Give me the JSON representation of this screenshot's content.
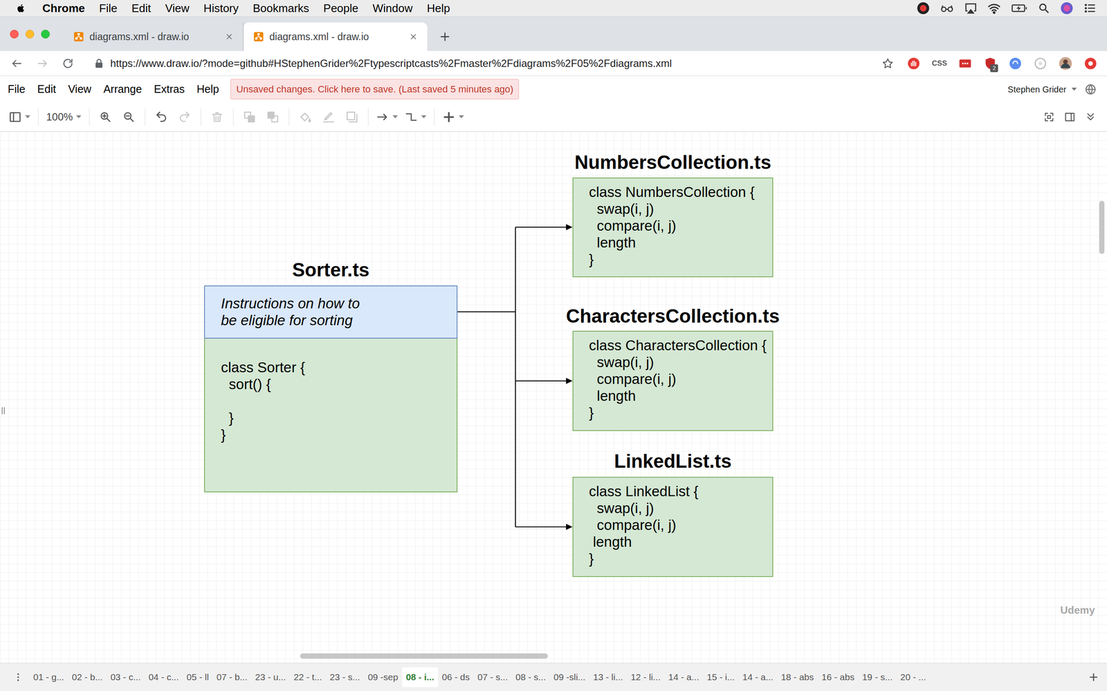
{
  "menubar": {
    "app": "Chrome",
    "items": [
      "File",
      "Edit",
      "View",
      "History",
      "Bookmarks",
      "People",
      "Window",
      "Help"
    ]
  },
  "browser": {
    "tabs": [
      {
        "title": "diagrams.xml - draw.io",
        "selected": false
      },
      {
        "title": "diagrams.xml - draw.io",
        "selected": true
      }
    ],
    "navigation": [
      {
        "kind": "back",
        "disabled": false
      },
      {
        "kind": "forward",
        "disabled": true
      },
      {
        "kind": "reload",
        "disabled": false
      }
    ],
    "url": "https://www.draw.io/?mode=github#HStephenGrider%2Ftypescriptcasts%2Fmaster%2Fdiagrams%2F05%2Fdiagrams.xml",
    "extensions": [
      {
        "kind": "adblock"
      },
      {
        "kind": "text",
        "label": "CSS"
      },
      {
        "kind": "box"
      },
      {
        "kind": "shield",
        "badge": "2"
      },
      {
        "kind": "blue"
      },
      {
        "kind": "grey"
      },
      {
        "kind": "avatar"
      },
      {
        "kind": "record"
      }
    ]
  },
  "drawio": {
    "menu": [
      "File",
      "Edit",
      "View",
      "Arrange",
      "Extras",
      "Help"
    ],
    "notice": "Unsaved changes. Click here to save. (Last saved 5 minutes ago)",
    "user": "Stephen Grider"
  },
  "toolbar": {
    "groups": [
      [
        {
          "kind": "format",
          "disabled": false,
          "dropdown": true
        }
      ],
      [
        {
          "kind": "zoomlevel",
          "label": "100%",
          "disabled": false,
          "dropdown": true
        }
      ],
      [
        {
          "kind": "zoomin",
          "disabled": false,
          "dropdown": false
        },
        {
          "kind": "zoomout",
          "disabled": false,
          "dropdown": false
        }
      ],
      [
        {
          "kind": "undo",
          "disabled": false,
          "dropdown": false
        },
        {
          "kind": "redo",
          "disabled": true,
          "dropdown": false
        }
      ],
      [
        {
          "kind": "delete",
          "disabled": true,
          "dropdown": false
        }
      ],
      [
        {
          "kind": "front",
          "disabled": true,
          "dropdown": false
        },
        {
          "kind": "back",
          "disabled": true,
          "dropdown": false
        }
      ],
      [
        {
          "kind": "fill",
          "disabled": true,
          "dropdown": false
        },
        {
          "kind": "line",
          "disabled": true,
          "dropdown": false
        },
        {
          "kind": "shadow",
          "disabled": true,
          "dropdown": false
        }
      ],
      [
        {
          "kind": "connection",
          "disabled": false,
          "dropdown": true
        },
        {
          "kind": "waypoint",
          "disabled": false,
          "dropdown": true
        }
      ],
      [
        {
          "kind": "insert",
          "disabled": false,
          "dropdown": true
        }
      ]
    ],
    "right": [
      {
        "kind": "fullscreen",
        "disabled": false
      },
      {
        "kind": "panel",
        "disabled": false
      },
      {
        "kind": "collapse",
        "disabled": false
      }
    ]
  },
  "diagram": {
    "sorter": {
      "title": "Sorter.ts",
      "header": [
        "Instructions on how to",
        "be eligible for sorting"
      ],
      "code": [
        "class Sorter {",
        "  sort() {",
        "",
        "  }",
        "}"
      ]
    },
    "collections": [
      {
        "title": "NumbersCollection.ts",
        "code": [
          "class NumbersCollection {",
          "  swap(i, j)",
          "  compare(i, j)",
          "  length",
          "}"
        ],
        "linked": true
      },
      {
        "title": "CharactersCollection.ts",
        "code": [
          "class CharactersCollection {",
          "  swap(i, j)",
          "  compare(i, j)",
          "  length",
          "}"
        ],
        "linked": true
      },
      {
        "title": "LinkedList.ts",
        "code": [
          "class LinkedList {",
          "  swap(i, j)",
          "  compare(i, j)",
          " length",
          "}"
        ],
        "linked": true
      }
    ]
  },
  "pages": [
    {
      "label": "01 - g...",
      "selected": false
    },
    {
      "label": "02 - b...",
      "selected": false
    },
    {
      "label": "03 - c...",
      "selected": false
    },
    {
      "label": "04 - c...",
      "selected": false
    },
    {
      "label": "05 - ll",
      "selected": false
    },
    {
      "label": "07 - b...",
      "selected": false
    },
    {
      "label": "23 - u...",
      "selected": false
    },
    {
      "label": "22 - t...",
      "selected": false
    },
    {
      "label": "23 - s...",
      "selected": false
    },
    {
      "label": "09 -sep",
      "selected": false
    },
    {
      "label": "08 - i...",
      "selected": true
    },
    {
      "label": "06 - ds",
      "selected": false
    },
    {
      "label": "07 - s...",
      "selected": false
    },
    {
      "label": "08 - s...",
      "selected": false
    },
    {
      "label": "09 -sli...",
      "selected": false
    },
    {
      "label": "13 - li...",
      "selected": false
    },
    {
      "label": "12 - li...",
      "selected": false
    },
    {
      "label": "14 - a...",
      "selected": false
    },
    {
      "label": "15 - i...",
      "selected": false
    },
    {
      "label": "14 - a...",
      "selected": false
    },
    {
      "label": "18 - abs",
      "selected": false
    },
    {
      "label": "16 - abs",
      "selected": false
    },
    {
      "label": "19 - s...",
      "selected": false
    },
    {
      "label": "20 - ...",
      "selected": false
    }
  ],
  "watermark": "Udemy"
}
